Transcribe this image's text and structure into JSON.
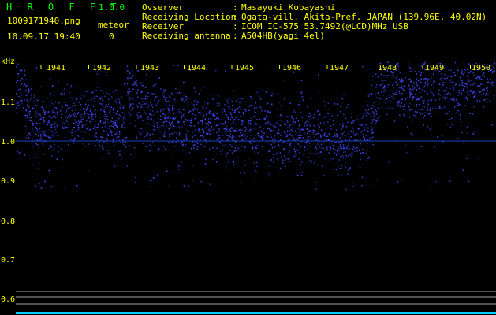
{
  "app": {
    "name": "H R O F F T",
    "version": "1.0.0"
  },
  "file": {
    "name": "1009171940.png",
    "datetime": "10.09.17 19:40"
  },
  "meteor": {
    "label": "meteor",
    "count": "0"
  },
  "info": [
    {
      "label": "Ovserver",
      "sep": ":",
      "value": "Masayuki Kobayashi"
    },
    {
      "label": "Receiving Location",
      "sep": ":",
      "value": "Ogata-vill. Akita-Pref. JAPAN (139.96E, 40.02N)"
    },
    {
      "label": "Receiver",
      "sep": ":",
      "value": "ICOM IC-575 53.7492(@LCD)MHz USB"
    },
    {
      "label": "Receiving antenna",
      "sep": ":",
      "value": "A504HB(yagi 4el)"
    }
  ],
  "spectrogram": {
    "unit": "kHz",
    "time_labels": [
      "1941",
      "1942",
      "1943",
      "1944",
      "1945",
      "1946",
      "1947",
      "1948",
      "1949",
      "1950"
    ],
    "freq_labels": [
      "1.1",
      "1.0",
      "0.9",
      "0.8",
      "0.7",
      "0.6"
    ],
    "colors": {
      "signal": "#3040ff",
      "axis_text": "#ffff00",
      "hline": "#1a40c0",
      "ref_line": "#a0a0a0",
      "bottom_bar": "#00d0ff"
    }
  }
}
